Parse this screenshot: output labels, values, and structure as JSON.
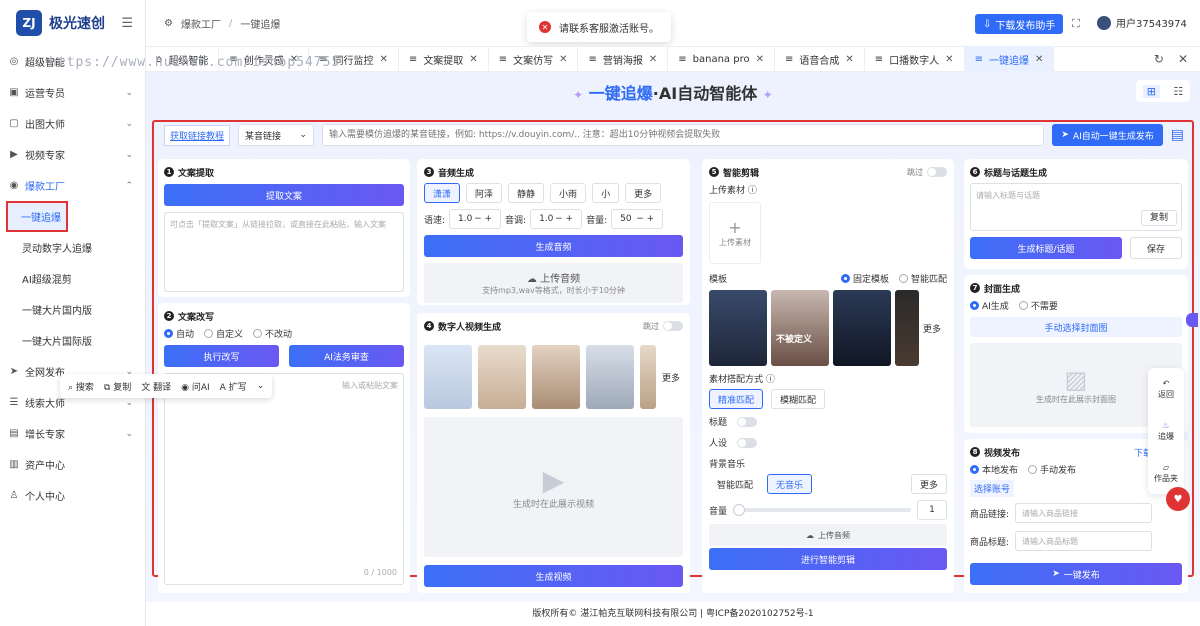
{
  "brand": {
    "name": "极光速创",
    "badge": "ZJ"
  },
  "sidebar": {
    "items": [
      {
        "label": "超级智能",
        "icon": "robot-icon",
        "glyph": "◎"
      },
      {
        "label": "运营专员",
        "icon": "calendar-icon",
        "glyph": "▣"
      },
      {
        "label": "出图大师",
        "icon": "image-icon",
        "glyph": "▢"
      },
      {
        "label": "视频专家",
        "icon": "video-icon",
        "glyph": "▶"
      },
      {
        "label": "爆款工厂",
        "icon": "factory-icon",
        "glyph": "◉"
      }
    ],
    "subitems": [
      "一键追爆",
      "灵动数字人追爆",
      "AI超级混剪",
      "一键大片国内版",
      "一键大片国际版"
    ],
    "items2": [
      {
        "label": "全网发布",
        "icon": "send-icon",
        "glyph": "➤"
      },
      {
        "label": "线索大师",
        "icon": "leads-icon",
        "glyph": "☰"
      },
      {
        "label": "增长专家",
        "icon": "growth-icon",
        "glyph": "▤"
      },
      {
        "label": "资产中心",
        "icon": "asset-icon",
        "glyph": "▥"
      },
      {
        "label": "个人中心",
        "icon": "person-icon",
        "glyph": "♙"
      }
    ]
  },
  "breadcrumb": {
    "parent": "爆款工厂",
    "sep": "/",
    "current": "一键追爆"
  },
  "toast": {
    "text": "请联系客服激活账号。"
  },
  "header": {
    "download": "下载发布助手",
    "user": "用户37543974"
  },
  "tabs": [
    "超级智能",
    "创作灵感",
    "同行监控",
    "文案提取",
    "文案仿写",
    "营销海报",
    "banana pro",
    "语音合成",
    "口播数字人",
    "一键追爆"
  ],
  "watermark": "https://www.huzhan.com/ishop54755",
  "hero": {
    "title1": "一键追爆",
    "title2": "·AI自动智能体"
  },
  "linkbar": {
    "tutorial": "获取链接教程",
    "source": "某音链接",
    "placeholder": "输入需要模仿追爆的某音链接，例如: https://v.douyin.com/.. 注意：超出10分钟视频会提取失败",
    "ai_button": "AI自动一键生成发布"
  },
  "p1": {
    "num": "1",
    "title": "文案提取",
    "button": "提取文案",
    "placeholder": "可点击「提取文案」从链接拉取，或直接在此粘贴，输入文案"
  },
  "p2": {
    "num": "2",
    "title": "文案改写",
    "modes": [
      "自动",
      "自定义",
      "不改动"
    ],
    "btn1": "执行改写",
    "btn2": "AI法务审查",
    "placeholder": "输入或粘贴文案",
    "counter": "0 / 1000"
  },
  "p3": {
    "num": "3",
    "title": "音频生成",
    "voices": [
      "潇潇",
      "阿泽",
      "静静",
      "小雨",
      "小"
    ],
    "more": "更多",
    "speed_label": "语速:",
    "speed": "1.0",
    "pitch_label": "音调:",
    "pitch": "1.0",
    "vol_label": "音量:",
    "vol": "50",
    "button": "生成音频",
    "upload": "上传音频",
    "upload_hint": "支持mp3,wav等格式，时长小于10分钟"
  },
  "p4": {
    "num": "4",
    "title": "数字人视频生成",
    "skip": "跳过",
    "more": "更多",
    "placeholder": "生成时在此展示视频",
    "button": "生成视频"
  },
  "p5": {
    "num": "5",
    "title": "智能剪辑",
    "skip": "跳过",
    "upload_label": "上传素材",
    "upload_btn": "上传素材",
    "template_label": "模板",
    "tmode1": "固定模板",
    "tmode2": "智能匹配",
    "more": "更多",
    "match_label": "素材搭配方式",
    "match1": "精准匹配",
    "match2": "模糊匹配",
    "title_label": "标题",
    "persona_label": "人设",
    "bgm_label": "背景音乐",
    "bgm1": "智能匹配",
    "bgm2": "无音乐",
    "bgm_more": "更多",
    "vol_label": "音量",
    "vol": "1",
    "upload_audio": "上传音频",
    "button": "进行智能剪辑",
    "thumb_text": "不被定义"
  },
  "p6": {
    "num": "6",
    "title": "标题与话题生成",
    "placeholder": "请输入标题与话题",
    "copy": "复制",
    "button": "生成标题/话题",
    "save": "保存"
  },
  "p7": {
    "num": "7",
    "title": "封面生成",
    "opt1": "AI生成",
    "opt2": "不需要",
    "manual": "手动选择封面图",
    "placeholder": "生成时在此展示封面图"
  },
  "p8": {
    "num": "8",
    "title": "视频发布",
    "download": "下载",
    "opt1": "本地发布",
    "opt2": "手动发布",
    "account": "选择账号",
    "link_label": "商品链接:",
    "link_ph": "请输入商品链接",
    "title_label": "商品标题:",
    "title_ph": "请输入商品标题",
    "button": "一键发布"
  },
  "floatbar": [
    "搜索",
    "复制",
    "翻译",
    "问AI",
    "扩写"
  ],
  "sidefloat": [
    "返回",
    "追爆",
    "作品夹"
  ],
  "footer": "版权所有© 湛江帕克互联网科技有限公司 | 粤ICP备2020102752号-1"
}
